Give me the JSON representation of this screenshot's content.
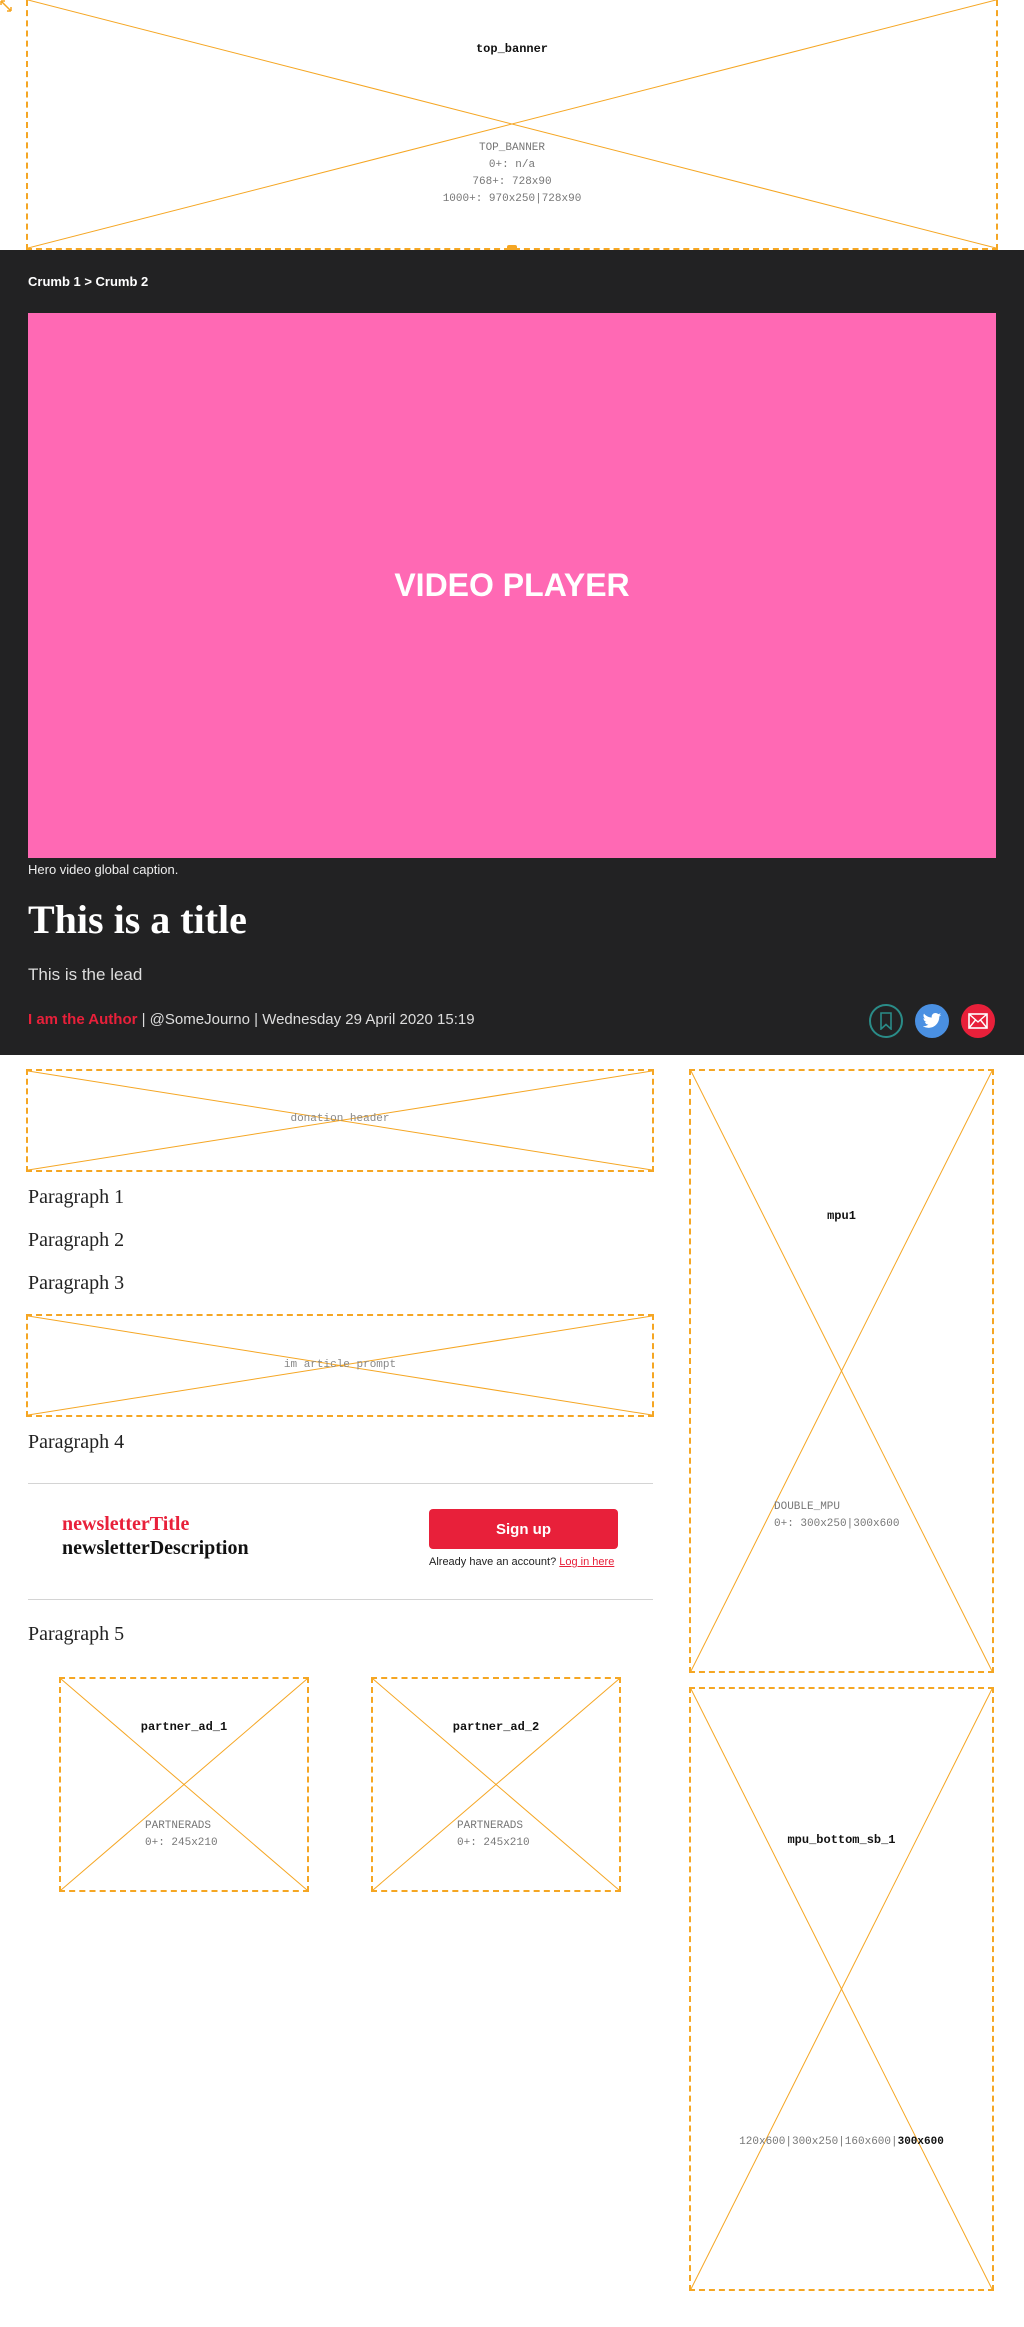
{
  "ads": {
    "top_banner": {
      "name": "top_banner",
      "info": "TOP_BANNER\n0+: n/a\n768+: 728x90\n1000+: 970x250|728x90"
    },
    "donation_header": {
      "label": "donation header"
    },
    "im_article_prompt": {
      "label": "im article prompt"
    },
    "mpu1": {
      "name": "mpu1",
      "info": "DOUBLE_MPU\n0+: 300x250|300x600"
    },
    "partner_ad_1": {
      "name": "partner_ad_1",
      "info": "PARTNERADS\n0+: 245x210"
    },
    "partner_ad_2": {
      "name": "partner_ad_2",
      "info": "PARTNERADS\n0+: 245x210"
    },
    "mpu_bottom_sb_1": {
      "name": "mpu_bottom_sb_1",
      "sizes": "120x600|300x250|160x600|",
      "sizes_highlight": "300x600"
    }
  },
  "breadcrumb": "Crumb 1 > Crumb 2",
  "video": {
    "label": "VIDEO PLAYER",
    "caption": "Hero video global caption."
  },
  "article": {
    "title": "This is a title",
    "lead": "This is the lead",
    "author": "I am the Author",
    "byline_rest": " | @SomeJourno | Wednesday 29 April 2020 15:19",
    "paragraphs": [
      "Paragraph 1",
      "Paragraph 2",
      "Paragraph 3",
      "Paragraph 4",
      "Paragraph 5"
    ]
  },
  "share": {
    "icons": [
      "bookmark-icon",
      "twitter-icon",
      "email-icon"
    ]
  },
  "newsletter": {
    "title": "newsletterTitle",
    "description": "newsletterDescription",
    "signup_label": "Sign up",
    "login_prompt": "Already have an account?",
    "login_link": "Log in here"
  },
  "colors": {
    "accent": "#e8203a",
    "hero_bg": "#222223",
    "video_bg": "#ff69b4",
    "ad_border": "#f5a623",
    "twitter": "#4a90e2",
    "save": "#2a8c88"
  }
}
